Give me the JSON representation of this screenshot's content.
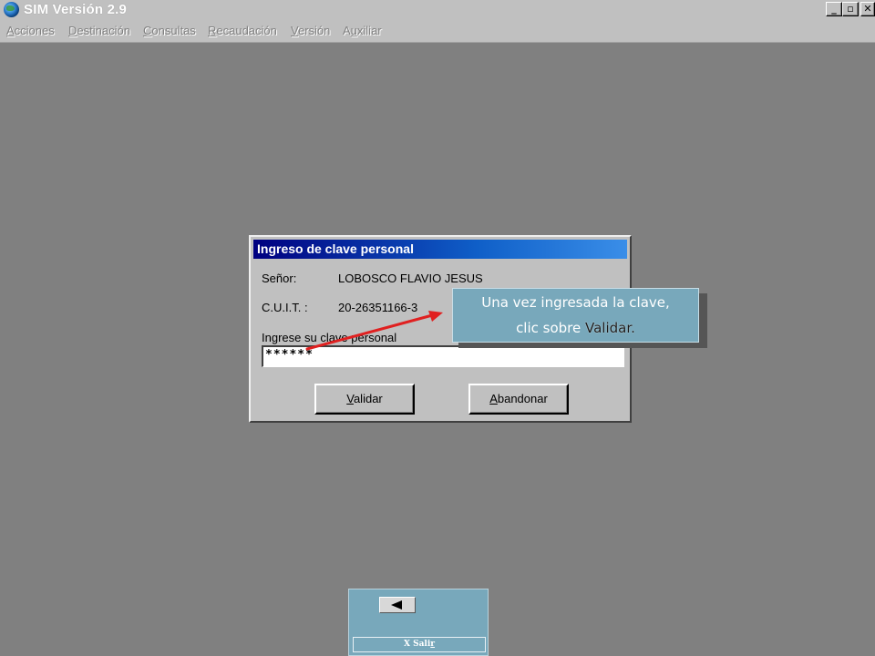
{
  "window": {
    "title": "SIM Versión 2.9",
    "controls": {
      "minimize": "_",
      "maximize": "▫",
      "close": "✕"
    }
  },
  "menu": {
    "items": [
      {
        "pre": "",
        "ul": "A",
        "post": "cciones"
      },
      {
        "pre": "",
        "ul": "D",
        "post": "estinación"
      },
      {
        "pre": "",
        "ul": "C",
        "post": "onsultas"
      },
      {
        "pre": "",
        "ul": "R",
        "post": "ecaudación"
      },
      {
        "pre": "",
        "ul": "V",
        "post": "ersión"
      },
      {
        "pre": "A",
        "ul": "u",
        "post": "xiliar"
      }
    ]
  },
  "dialog": {
    "title": "Ingreso de clave personal",
    "senor_label": "Señor:",
    "senor_value": "LOBOSCO FLAVIO JESUS",
    "cuit_label": "C.U.I.T. :",
    "cuit_value": "20-26351166-3",
    "password_label": "Ingrese su clave personal",
    "password_value": "******",
    "validate_button": {
      "ul": "V",
      "rest": "alidar"
    },
    "abandon_button": {
      "ul": "A",
      "rest": "bandonar"
    }
  },
  "tooltip": {
    "line1": "Una vez ingresada la clave,",
    "line2_prefix": "clic sobre ",
    "line2_highlight": "Validar."
  },
  "nav": {
    "exit_prefix": "X  Sali",
    "exit_ul": "r"
  },
  "colors": {
    "desktop": "#808080",
    "callout": "#78a8bb",
    "arrow": "#e02020"
  }
}
